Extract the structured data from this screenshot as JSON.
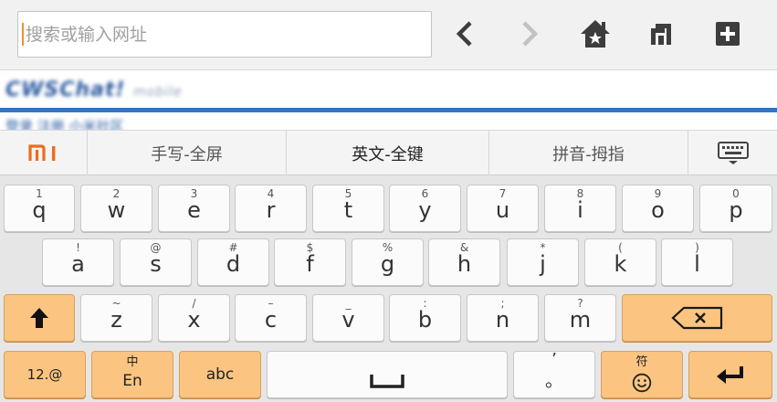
{
  "browser": {
    "search_placeholder": "搜索或输入网址",
    "icons": [
      "back-arrow-icon",
      "forward-arrow-icon",
      "home-icon",
      "tabs-icon",
      "new-tab-icon"
    ]
  },
  "keyboard": {
    "brand": "MI",
    "modes": [
      {
        "label": "手写-全屏"
      },
      {
        "label": "英文-全键"
      },
      {
        "label": "拼音-拇指"
      }
    ],
    "row1": [
      {
        "sub": "1",
        "main": "q"
      },
      {
        "sub": "2",
        "main": "w"
      },
      {
        "sub": "3",
        "main": "e"
      },
      {
        "sub": "4",
        "main": "r"
      },
      {
        "sub": "5",
        "main": "t"
      },
      {
        "sub": "6",
        "main": "y"
      },
      {
        "sub": "7",
        "main": "u"
      },
      {
        "sub": "8",
        "main": "i"
      },
      {
        "sub": "9",
        "main": "o"
      },
      {
        "sub": "0",
        "main": "p"
      }
    ],
    "row2": [
      {
        "sub": "!",
        "main": "a"
      },
      {
        "sub": "@",
        "main": "s"
      },
      {
        "sub": "#",
        "main": "d"
      },
      {
        "sub": "$",
        "main": "f"
      },
      {
        "sub": "%",
        "main": "g"
      },
      {
        "sub": "&",
        "main": "h"
      },
      {
        "sub": "*",
        "main": "j"
      },
      {
        "sub": "(",
        "main": "k"
      },
      {
        "sub": ")",
        "main": "l"
      }
    ],
    "row3": [
      {
        "sub": "~",
        "main": "z"
      },
      {
        "sub": "/",
        "main": "x"
      },
      {
        "sub": "–",
        "main": "c"
      },
      {
        "sub": "_",
        "main": "v"
      },
      {
        "sub": ":",
        "main": "b"
      },
      {
        "sub": ";",
        "main": "n"
      },
      {
        "sub": "?",
        "main": "m"
      }
    ],
    "bottom": {
      "num_label": "12.@",
      "lang_top": "中",
      "lang_bottom": "En",
      "abc_label": "abc",
      "punct_top": "’",
      "punct_bottom": "。",
      "symbol_label": "符"
    },
    "colors": {
      "function_key": "#fbc581",
      "letter_key": "#fbfbfb",
      "accent": "#ea6d1e"
    }
  }
}
